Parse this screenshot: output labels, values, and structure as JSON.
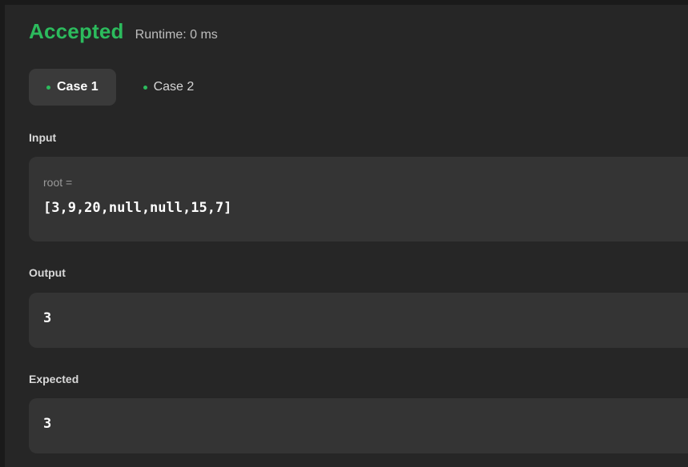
{
  "result": {
    "status": "Accepted",
    "runtime": "Runtime: 0 ms",
    "status_color": "#2cbb5d"
  },
  "tabs": [
    {
      "label": "Case 1",
      "active": true
    },
    {
      "label": "Case 2",
      "active": false
    }
  ],
  "input": {
    "section_label": "Input",
    "param_label": "root =",
    "value": "[3,9,20,null,null,15,7]"
  },
  "output": {
    "section_label": "Output",
    "value": "3"
  },
  "expected": {
    "section_label": "Expected",
    "value": "3"
  }
}
